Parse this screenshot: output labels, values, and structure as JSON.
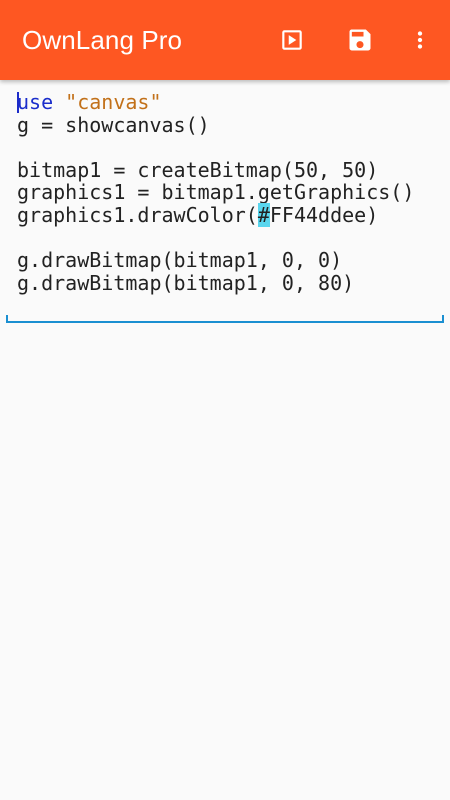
{
  "app_bar": {
    "title": "OwnLang Pro",
    "background_color": "#fe5722",
    "actions": [
      {
        "name": "run",
        "icon": "play-box-icon"
      },
      {
        "name": "save",
        "icon": "floppy-disk-icon"
      },
      {
        "name": "more",
        "icon": "more-vertical-icon"
      }
    ]
  },
  "editor": {
    "accent_color": "#1a8fd1",
    "lines": {
      "l1_keyword": "use",
      "l1_string": "\"canvas\"",
      "l2": "g = showcanvas()",
      "l3": "",
      "l4": "bitmap1 = createBitmap(50, 50)",
      "l5": "graphics1 = bitmap1.getGraphics()",
      "l6_before": "graphics1.drawColor(",
      "l6_highlight": "#",
      "l6_after": "FF44ddee)",
      "l7": "",
      "l8": "g.drawBitmap(bitmap1, 0, 0)",
      "l9": "g.drawBitmap(bitmap1, 0, 80)"
    }
  }
}
